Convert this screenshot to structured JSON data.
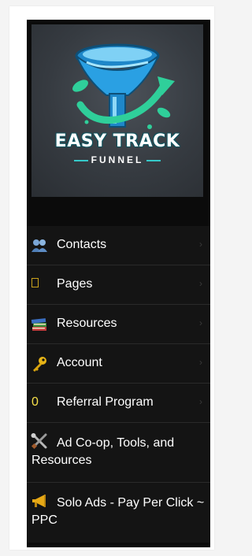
{
  "logo": {
    "title": "EASY TRACK",
    "subtitle": "FUNNEL"
  },
  "menu": {
    "items": [
      {
        "label": "Contacts",
        "icon": "contacts-people-icon"
      },
      {
        "label": "Pages",
        "icon": "pages-box-icon"
      },
      {
        "label": "Resources",
        "icon": "books-icon"
      },
      {
        "label": "Account",
        "icon": "key-icon"
      },
      {
        "label": "Referral Program",
        "icon_text": "0"
      },
      {
        "label": "Ad Co-op, Tools, and Resources",
        "icon": "tools-icon"
      },
      {
        "label": "Solo Ads - Pay Per Click ~ PPC",
        "icon": "megaphone-icon"
      }
    ],
    "chevron": "›"
  },
  "colors": {
    "panel_bg": "#0b0b0b",
    "item_bg": "#141414",
    "accent_teal": "#35c9c9"
  }
}
